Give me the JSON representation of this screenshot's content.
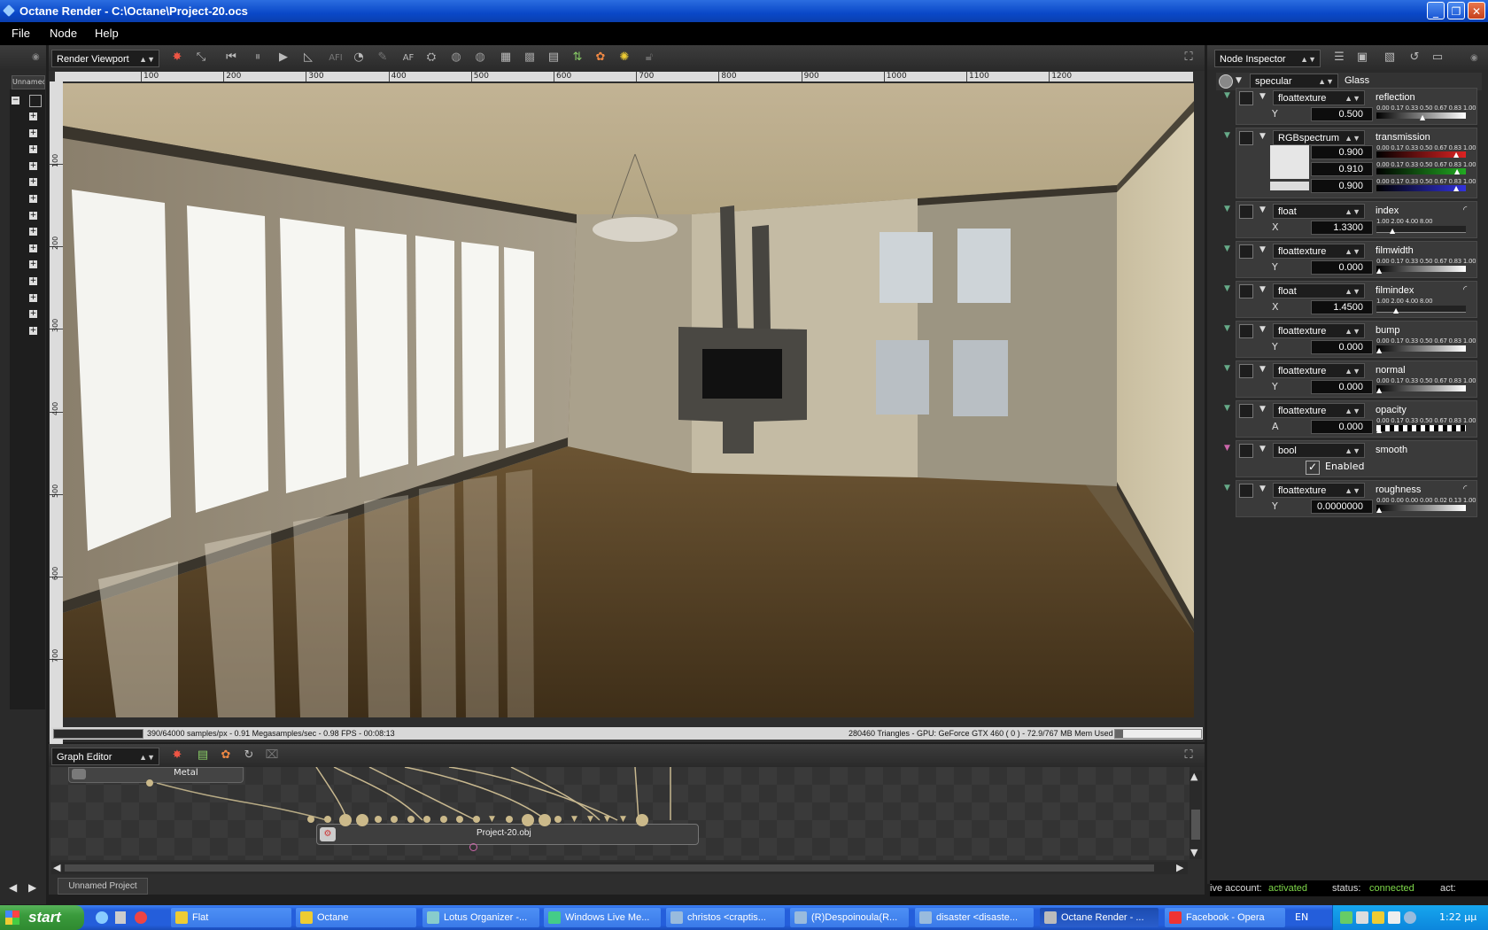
{
  "window": {
    "title": "Octane Render - C:\\Octane\\Project-20.ocs"
  },
  "menu": [
    "File",
    "Node",
    "Help"
  ],
  "viewport": {
    "dropdown": "Render Viewport",
    "ruler_top": [
      "100",
      "200",
      "300",
      "400",
      "500",
      "600",
      "700",
      "800",
      "900",
      "1000",
      "1100",
      "1200"
    ],
    "ruler_left": [
      "100",
      "200",
      "300",
      "400",
      "500",
      "600",
      "700"
    ],
    "status_left": "390/64000 samples/px - 0.91 Megasamples/sec - 0.98 FPS - 00:08:13",
    "status_right": "280460 Triangles - GPU: GeForce GTX 460 ( 0 ) - 72.9/767 MB Mem Used"
  },
  "left_panel": {
    "tab": "Unnamed"
  },
  "inspector": {
    "dropdown": "Node Inspector",
    "node_type": "specular",
    "node_name": "Glass",
    "params": [
      {
        "type": "floattexture",
        "name": "reflection",
        "axis": "Y",
        "value": "0.500",
        "scale": "0.00 0.17 0.33 0.50 0.67 0.83 1.00",
        "level": 0.5
      },
      {
        "type": "RGBspectrum",
        "name": "transmission",
        "values": [
          "0.900",
          "0.910",
          "0.900"
        ],
        "scale": "0.00 0.17 0.33 0.50 0.67 0.83 1.00",
        "levels": [
          0.9,
          0.91,
          0.9
        ]
      },
      {
        "type": "float",
        "name": "index",
        "axis": "X",
        "value": "1.3300",
        "scale": "1.00 2.00 4.00 8.00"
      },
      {
        "type": "floattexture",
        "name": "filmwidth",
        "axis": "Y",
        "value": "0.000",
        "scale": "0.00 0.17 0.33 0.50 0.67 0.83 1.00",
        "level": 0
      },
      {
        "type": "float",
        "name": "filmindex",
        "axis": "X",
        "value": "1.4500",
        "scale": "1.00 2.00 4.00 8.00"
      },
      {
        "type": "floattexture",
        "name": "bump",
        "axis": "Y",
        "value": "0.000",
        "scale": "0.00 0.17 0.33 0.50 0.67 0.83 1.00",
        "level": 0
      },
      {
        "type": "floattexture",
        "name": "normal",
        "axis": "Y",
        "value": "0.000",
        "scale": "0.00 0.17 0.33 0.50 0.67 0.83 1.00",
        "level": 0
      },
      {
        "type": "floattexture",
        "name": "opacity",
        "axis": "A",
        "value": "0.000",
        "scale": "0.00 0.17 0.33 0.50 0.67 0.83 1.00",
        "level": 0
      },
      {
        "type": "bool",
        "name": "smooth",
        "checkbox_label": "Enabled",
        "checked": true
      },
      {
        "type": "floattexture",
        "name": "roughness",
        "axis": "Y",
        "value": "0.0000000",
        "scale": "0.00 0.00 0.00 0.00 0.02 0.13 1.00",
        "level": 0
      }
    ]
  },
  "graph_editor": {
    "dropdown": "Graph Editor",
    "node_metal": "Metal",
    "node_mesh": "Project-20.obj",
    "tab": "Unnamed Project"
  },
  "live_status": {
    "account_label": "ive account:",
    "account_value": "activated",
    "status_label": "status:",
    "status_value": "connected",
    "act_label": "act:"
  },
  "taskbar": {
    "start": "start",
    "tasks": [
      "Flat",
      "Octane",
      "Lotus Organizer -...",
      "Windows Live Me...",
      "christos <craptis...",
      "(R)Despoinoula(R...",
      "disaster <disaste...",
      "Octane Render - ...",
      "Facebook - Opera"
    ],
    "lang": "EN",
    "clock": "1:22 μμ"
  },
  "colors": {
    "accent_green": "#7fd94a",
    "titlebar_blue": "#0a48c8",
    "taskbar_blue": "#245edb"
  }
}
